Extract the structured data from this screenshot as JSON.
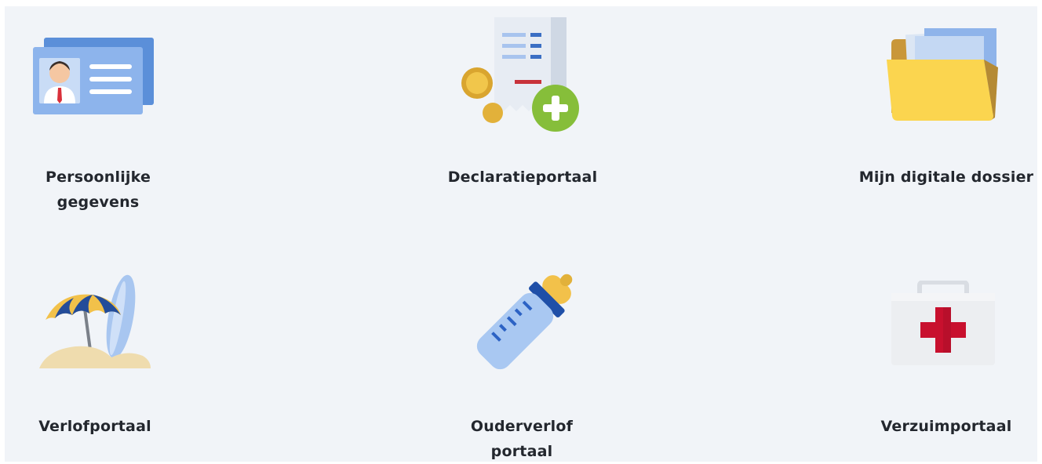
{
  "tiles": [
    {
      "id": "persoonlijke",
      "label": "Persoonlijke gegevens",
      "icon": "id-card-icon"
    },
    {
      "id": "declaratie",
      "label": "Declaratieportaal",
      "icon": "receipt-add-icon"
    },
    {
      "id": "dossier",
      "label": "Mijn digitale dossier",
      "icon": "folder-icon"
    },
    {
      "id": "verlof",
      "label": "Verlofportaal",
      "icon": "beach-umbrella-icon"
    },
    {
      "id": "ouderverlof",
      "label": "Ouderverlof portaal",
      "icon": "baby-bottle-icon"
    },
    {
      "id": "verzuim",
      "label": "Verzuimportaal",
      "icon": "first-aid-kit-icon"
    }
  ],
  "colors": {
    "panel_background": "#f1f4f8",
    "label_text": "#23272e",
    "card_blue": "#7ea7e6",
    "folder_yellow": "#fbd54f",
    "plus_green": "#86be3a",
    "cross_red": "#c8102e"
  }
}
